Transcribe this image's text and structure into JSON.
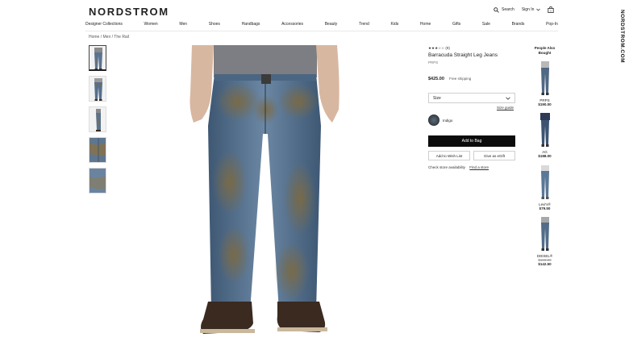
{
  "header": {
    "logo": "NORDSTROM",
    "search_label": "Search",
    "signin_label": "Sign In"
  },
  "nav": [
    "Designer Collections",
    "Women",
    "Men",
    "Shoes",
    "Handbags",
    "Accessories",
    "Beauty",
    "Trend",
    "Kids",
    "Home",
    "Gifts",
    "Sale",
    "Brands",
    "Pop-In"
  ],
  "breadcrumb": "Home  /  Men  /  The Rail",
  "product": {
    "rating": "★★★☆☆  (9)",
    "title": "Barracuda Straight Leg Jeans",
    "brand": "PRPS",
    "price": "$425.00",
    "shipping": "Free shipping",
    "size_label": "Size",
    "size_guide": "Size guide",
    "color": "Indigo",
    "add_to_bag": "Add to Bag",
    "wish_list": "Add to Wish List",
    "egift": "Give as eGift",
    "store_text": "Check store availability",
    "find_store": "Find a store"
  },
  "people_also_bought": {
    "title": "People Also Bought",
    "items": [
      {
        "brand": "PRPS",
        "price": "$190.00",
        "old_price": ""
      },
      {
        "brand": "AG",
        "price": "$188.00",
        "old_price": ""
      },
      {
        "brand": "Levi's®",
        "price": "$79.50",
        "old_price": ""
      },
      {
        "brand": "DIESEL®",
        "price": "$142.50",
        "old_price": "$190.00"
      }
    ]
  },
  "watermark": "NORDSTROM.COM",
  "colors": {
    "button": "#0c0c0c",
    "denim": "#4d6a86",
    "mud": "#7a6a4a"
  },
  "icons": [
    "search-icon",
    "bag-icon",
    "chevron-down-icon"
  ]
}
